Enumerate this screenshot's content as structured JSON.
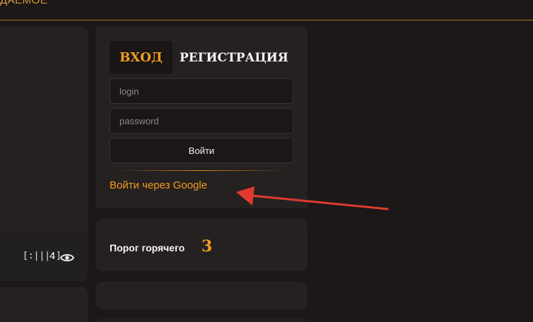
{
  "header": {
    "brand": "ДАЕМОЕ"
  },
  "left_card": {
    "barcode": "[:|||:]",
    "views": "4"
  },
  "login": {
    "tab_login": "ВХОД",
    "tab_register": "РЕГИСТРАЦИЯ",
    "login_placeholder": "login",
    "password_placeholder": "password",
    "submit_label": "Войти",
    "google_link": "Войти через Google"
  },
  "hot": {
    "label": "Порог горячего",
    "value": "3"
  },
  "colors": {
    "accent": "#f39d22",
    "background": "#1b1817",
    "card": "#252120",
    "arrow": "#e03a2f"
  }
}
